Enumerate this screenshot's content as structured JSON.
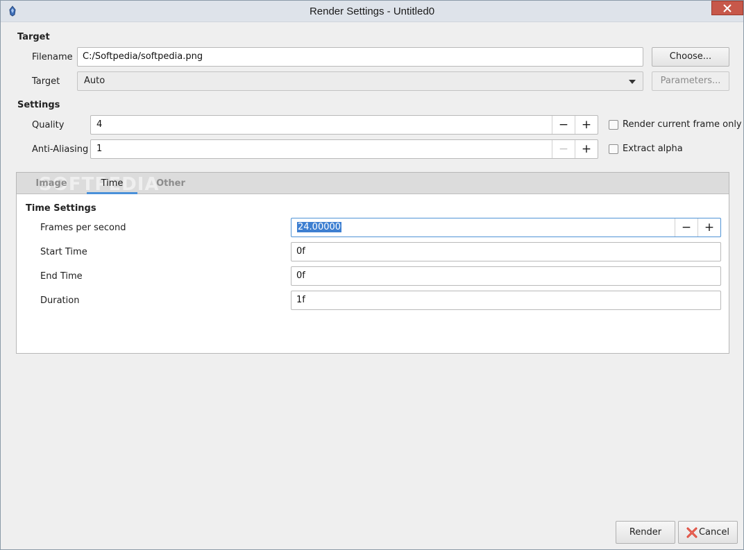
{
  "window": {
    "title": "Render Settings - Untitled0"
  },
  "target": {
    "section_title": "Target",
    "filename_label": "Filename",
    "filename_value": "C:/Softpedia/softpedia.png",
    "choose_label": "Choose...",
    "target_label": "Target",
    "target_value": "Auto",
    "parameters_label": "Parameters..."
  },
  "settings": {
    "section_title": "Settings",
    "quality_label": "Quality",
    "quality_value": "4",
    "antialiasing_label": "Anti-Aliasing",
    "antialiasing_value": "1",
    "render_current_frame_label": "Render current frame only",
    "extract_alpha_label": "Extract alpha",
    "minus": "−",
    "plus": "+"
  },
  "tabs": {
    "items": [
      {
        "label": "Image"
      },
      {
        "label": "Time"
      },
      {
        "label": "Other"
      }
    ],
    "watermark": "SOFTPEDIA"
  },
  "time_settings": {
    "section_title": "Time Settings",
    "fps_label": "Frames per second",
    "fps_value": "24.00000",
    "start_label": "Start Time",
    "start_value": "0f",
    "end_label": "End Time",
    "end_value": "0f",
    "duration_label": "Duration",
    "duration_value": "1f"
  },
  "footer": {
    "render_label": "Render",
    "cancel_label": "Cancel"
  },
  "colors": {
    "accent": "#4a90d9",
    "close_button": "#c7584a",
    "selection": "#3d7fd1"
  }
}
